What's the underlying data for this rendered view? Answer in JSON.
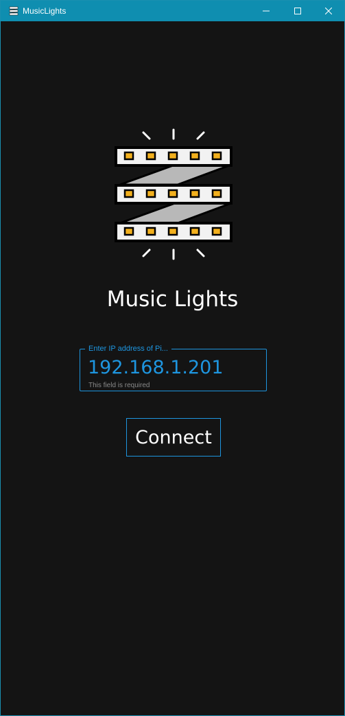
{
  "window": {
    "title": "MusicLights",
    "accent_color": "#0f8eb0"
  },
  "titlebar": {
    "icons": [
      "app-icon",
      "minimize-icon",
      "maximize-icon",
      "close-icon"
    ]
  },
  "main": {
    "heading": "Music Lights",
    "logo_icon": "led-strip-icon",
    "ip_field": {
      "label": "Enter IP address of Pi...",
      "value": "192.168.1.201",
      "helper_text": "This field is required"
    },
    "connect_button": {
      "label": "Connect"
    },
    "colors": {
      "background": "#141414",
      "accent": "#1e96e0",
      "text": "#ffffff",
      "led": "#f2b01e"
    }
  }
}
